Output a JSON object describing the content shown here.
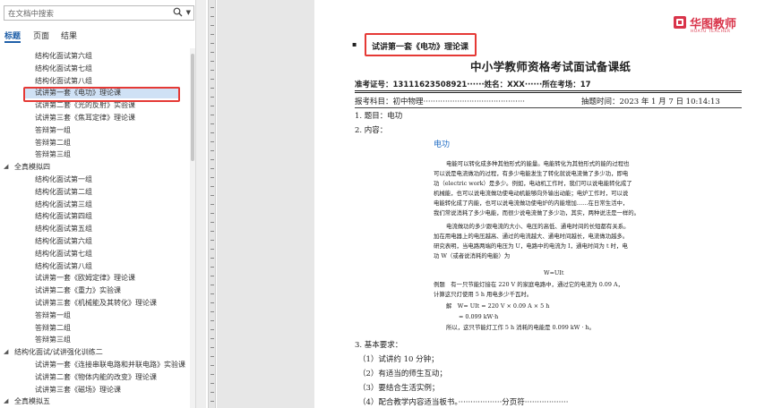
{
  "nav": {
    "search_placeholder": "在文档中搜索",
    "tabs": [
      "标题",
      "页面",
      "结果"
    ],
    "tree": [
      {
        "label": "结构化面试第六组",
        "level": 2
      },
      {
        "label": "结构化面试第七组",
        "level": 2
      },
      {
        "label": "结构化面试第八组",
        "level": 2
      },
      {
        "label": "试讲第一套《电功》理论课",
        "level": 2,
        "selected": true
      },
      {
        "label": "试讲第二套《光的反射》实验课",
        "level": 2
      },
      {
        "label": "试讲第三套《焦耳定律》理论课",
        "level": 2
      },
      {
        "label": "答辩第一组",
        "level": 2
      },
      {
        "label": "答辩第二组",
        "level": 2
      },
      {
        "label": "答辩第三组",
        "level": 2
      },
      {
        "label": "全真模拟四",
        "level": 1,
        "expanded": true
      },
      {
        "label": "结构化面试第一组",
        "level": 2
      },
      {
        "label": "结构化面试第二组",
        "level": 2
      },
      {
        "label": "结构化面试第三组",
        "level": 2
      },
      {
        "label": "结构化面试第四组",
        "level": 2
      },
      {
        "label": "结构化面试第五组",
        "level": 2
      },
      {
        "label": "结构化面试第六组",
        "level": 2
      },
      {
        "label": "结构化面试第七组",
        "level": 2
      },
      {
        "label": "结构化面试第八组",
        "level": 2
      },
      {
        "label": "试讲第一套《欧姆定律》理论课",
        "level": 2
      },
      {
        "label": "试讲第二套《重力》实验课",
        "level": 2
      },
      {
        "label": "试讲第三套《机械能及其转化》理论课",
        "level": 2
      },
      {
        "label": "答辩第一组",
        "level": 2
      },
      {
        "label": "答辩第二组",
        "level": 2
      },
      {
        "label": "答辩第三组",
        "level": 2
      },
      {
        "label": "结构化面试/试讲强化训练二",
        "level": 1,
        "expanded": true
      },
      {
        "label": "试讲第一套《连接串联电路和并联电路》实验课",
        "level": 2
      },
      {
        "label": "试讲第二套《物体内能的改变》理论课",
        "level": 2
      },
      {
        "label": "试讲第三套《磁场》理论课",
        "level": 2
      },
      {
        "label": "全真模拟五",
        "level": 1,
        "expanded": true
      }
    ]
  },
  "logo": {
    "name": "华图教师",
    "sub": "HUATU TEACHER"
  },
  "document": {
    "heading": "试讲第一套《电功》理论课",
    "title": "中小学教师资格考试面试备课纸",
    "candidate_line": "准考证号：13111623508921······姓名：XXX······所在考场：17",
    "subject_line": "报考科目：初中物理··········································",
    "draw_time": "抽题时间：2023 年 1 月 7 日 10:14:13",
    "item1": "1. 题目：电功",
    "item2": "2. 内容：",
    "topic_heading": "电功",
    "content_lines": [
      "电能可以转化成多种其他形式的能量。电能转化为其他形式的能的过程也",
      "可以说是电流做功的过程，有多少电能发生了转化就说电流做了多少功，即电",
      "功（electric work）是多少。例如，电动机工作时，我们可以说电能转化成了",
      "机械能，也可以说电流做功使电动机能够向外输出动能；电炉工作时，可以说",
      "电能转化成了内能，也可以说电流做功使电炉的内能增加……在日常生活中，",
      "我们常说消耗了多少电能，而很少说电流做了多少功，其实，两种说法是一样的。",
      "电流做功的多少跟电流的大小、电压的高低、通电时间的长短都有关系。",
      "加在用电器上的电压越高、通过的电流越大、通电时间越长，电流做功越多。",
      "研究表明，当电路两端的电压为 U，电路中的电流为 I，通电时间为 t 时，电",
      "功 W（或者说消耗的电能）为",
      "W=UIt",
      "例题　有一只节能灯接在 220 V 的家庭电路中，通过它的电流为 0.09 A，",
      "计算这只灯使用 5 h 用电多少千瓦时。",
      "解　W= UIt = 220 V × 0.09 A × 5 h",
      "= 0.099 kW·h",
      "所以，这只节能灯工作 5 h 消耗的电能是 0.099 kW · h。"
    ],
    "requirements_heading": "3. 基本要求：",
    "requirements": [
      "（1）试讲约 10 分钟；",
      "（2）有适当的师生互动；",
      "（3）要结合生活实例；",
      "（4）配合教学内容适当板书。··················分页符··················"
    ]
  }
}
